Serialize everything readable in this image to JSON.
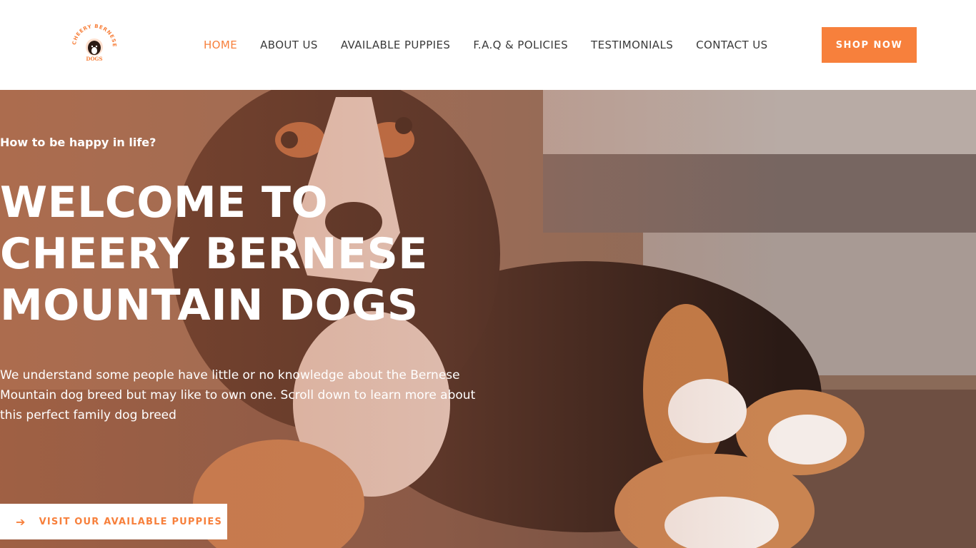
{
  "brand": {
    "logo_text_top": "CHEERY BERNESE MOUNTAIN",
    "logo_text_bottom": "DOGS"
  },
  "nav": {
    "items": [
      {
        "label": "HOME",
        "active": true
      },
      {
        "label": "ABOUT US",
        "active": false
      },
      {
        "label": "AVAILABLE PUPPIES",
        "active": false
      },
      {
        "label": "F.A.Q & POLICIES",
        "active": false
      },
      {
        "label": "TESTIMONIALS",
        "active": false
      },
      {
        "label": "CONTACT US",
        "active": false
      }
    ],
    "shop_label": "SHOP NOW"
  },
  "hero": {
    "eyebrow": "How to be happy in life?",
    "title": "WELCOME TO CHEERY BERNESE MOUNTAIN DOGS",
    "text": "We understand some people have little or no knowledge about the Bernese Mountain dog breed but may like to own one. Scroll down to learn more about this perfect family dog breed",
    "cta_label": "VISIT OUR AVAILABLE PUPPIES"
  },
  "colors": {
    "accent": "#f7803c",
    "nav_text": "#3a3a3a",
    "white": "#ffffff"
  },
  "icons": {
    "cta_icon": "arrow-right-icon"
  }
}
